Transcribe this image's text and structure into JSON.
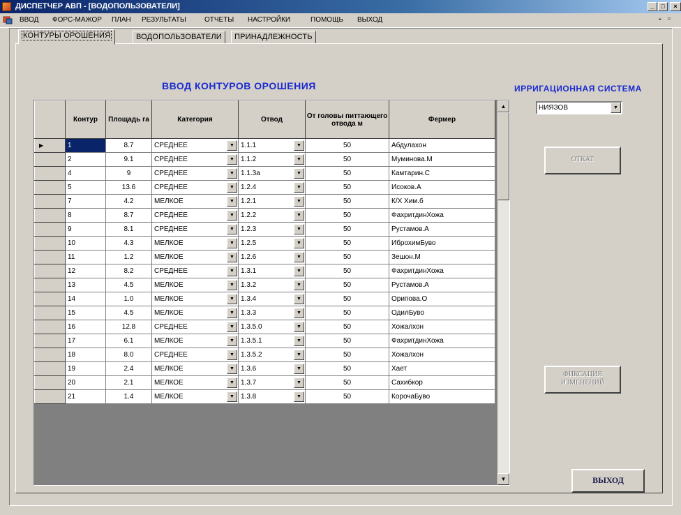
{
  "window": {
    "title": "ДИСПЕТЧЕР АВП - [ВОДОПОЛЬЗОВАТЕЛИ]"
  },
  "menu": {
    "items": [
      "ВВОД",
      "ФОРС-МАЖОР",
      "ПЛАН",
      "РЕЗУЛЬТАТЫ",
      "ОТЧЕТЫ",
      "НАСТРОЙКИ",
      "ПОМОЩЬ",
      "ВЫХОД"
    ]
  },
  "tabs": [
    "КОНТУРЫ ОРОШЕНИЯ",
    "ВОДОПОЛЬЗОВАТЕЛИ",
    "ПРИНАДЛЕЖНОСТЬ"
  ],
  "main": {
    "heading": "ВВОД КОНТУРОВ ОРОШЕНИЯ",
    "system_label": "ИРРИГАЦИОННАЯ СИСТЕМА",
    "system_value": "НИЯЗОВ"
  },
  "grid": {
    "columns": [
      "Контур",
      "Площадь га",
      "Категория",
      "Отвод",
      "От головы питтающего отвода м",
      "Фермер"
    ],
    "rows": [
      [
        "1",
        "8.7",
        "СРЕДНЕЕ",
        "1.1.1",
        "50",
        "Абдулахон"
      ],
      [
        "2",
        "9.1",
        "СРЕДНЕЕ",
        "1.1.2",
        "50",
        "Муминова.М"
      ],
      [
        "4",
        "9",
        "СРЕДНЕЕ",
        "1.1.3а",
        "50",
        "Камтарин.С"
      ],
      [
        "5",
        "13.6",
        "СРЕДНЕЕ",
        "1.2.4",
        "50",
        "Исоков.А"
      ],
      [
        "7",
        "4.2",
        "МЕЛКОЕ",
        "1.2.1",
        "50",
        "К/Х Хим.б"
      ],
      [
        "8",
        "8.7",
        "СРЕДНЕЕ",
        "1.2.2",
        "50",
        "ФахритдинХожа"
      ],
      [
        "9",
        "8.1",
        "СРЕДНЕЕ",
        "1.2.3",
        "50",
        "Рустамов.А"
      ],
      [
        "10",
        "4.3",
        "МЕЛКОЕ",
        "1.2.5",
        "50",
        "ИброхимБуво"
      ],
      [
        "11",
        "1.2",
        "МЕЛКОЕ",
        "1.2.6",
        "50",
        "Зешон.М"
      ],
      [
        "12",
        "8.2",
        "СРЕДНЕЕ",
        "1.3.1",
        "50",
        "ФахритдинХожа"
      ],
      [
        "13",
        "4.5",
        "МЕЛКОЕ",
        "1.3.2",
        "50",
        "Рустамов.А"
      ],
      [
        "14",
        "1.0",
        "МЕЛКОЕ",
        "1.3.4",
        "50",
        "Орипова.О"
      ],
      [
        "15",
        "4.5",
        "МЕЛКОЕ",
        "1.3.3",
        "50",
        "ОдилБуво"
      ],
      [
        "16",
        "12.8",
        "СРЕДНЕЕ",
        "1.3.5.0",
        "50",
        "Хожалхон"
      ],
      [
        "17",
        "6.1",
        "МЕЛКОЕ",
        "1.3.5.1",
        "50",
        "ФахритдинХожа"
      ],
      [
        "18",
        "8.0",
        "СРЕДНЕЕ",
        "1.3.5.2",
        "50",
        "Хожалхон"
      ],
      [
        "19",
        "2.4",
        "МЕЛКОЕ",
        "1.3.6",
        "50",
        "Хает"
      ],
      [
        "20",
        "2.1",
        "МЕЛКОЕ",
        "1.3.7",
        "50",
        "Сахибкор"
      ],
      [
        "21",
        "1.4",
        "МЕЛКОЕ",
        "1.3.8",
        "50",
        "КорочаБуво"
      ]
    ]
  },
  "buttons": {
    "rollback": "ОТКАТ",
    "commit_line1": "ФИКСАЦИЯ",
    "commit_line2": "ИЗМЕНЕНИЙ",
    "exit": "ВЫХОД"
  },
  "colors": {
    "heading": "#1a2ad0",
    "selection": "#0a246a",
    "titlebar": "#0a246a"
  }
}
